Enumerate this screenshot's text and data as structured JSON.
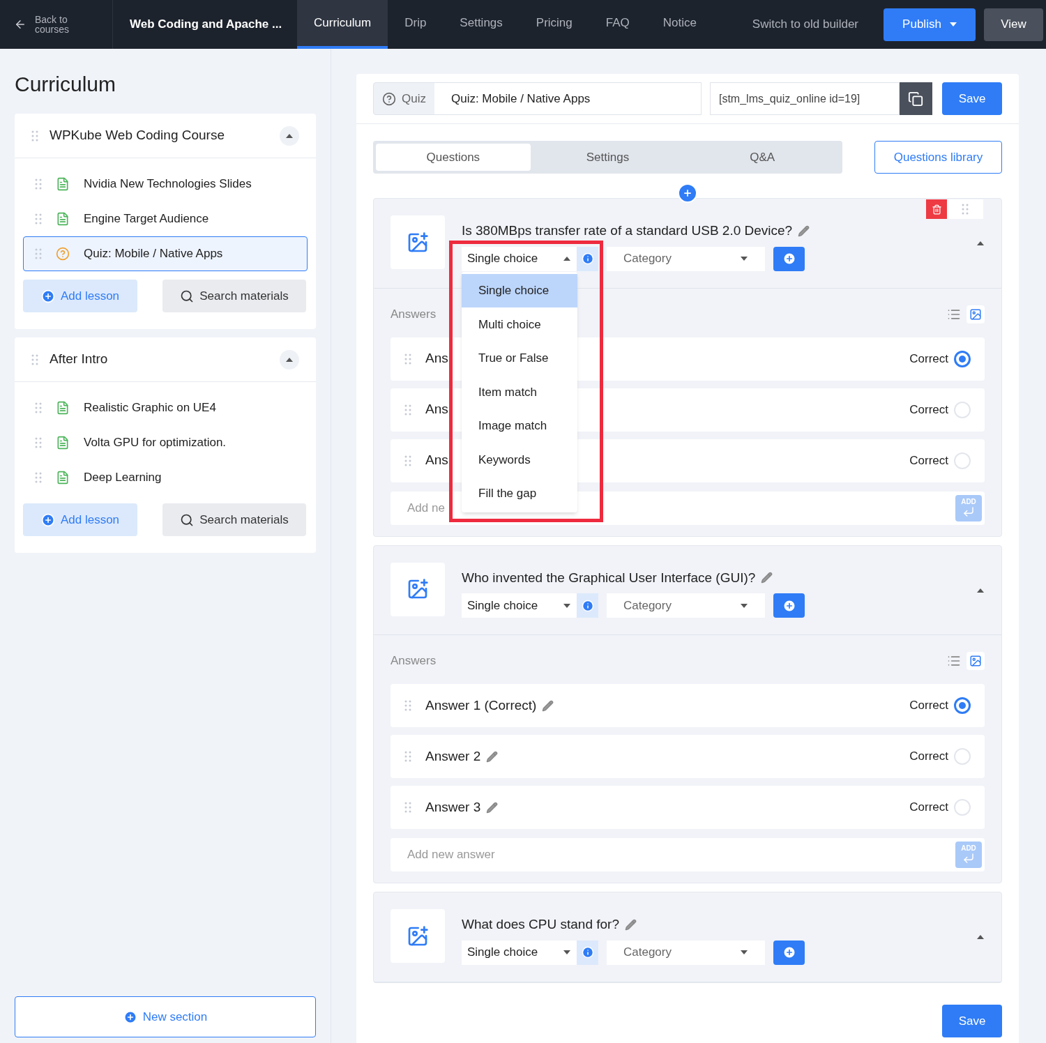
{
  "top_bar": {
    "back": "Back to courses",
    "course_title": "Web Coding and Apache ...",
    "tabs": [
      {
        "label": "Curriculum",
        "selected": true
      },
      {
        "label": "Drip",
        "selected": false
      },
      {
        "label": "Settings",
        "selected": false
      },
      {
        "label": "Pricing",
        "selected": false
      },
      {
        "label": "FAQ",
        "selected": false
      },
      {
        "label": "Notice",
        "selected": false
      }
    ],
    "switch_label": "Switch to old builder",
    "publish": "Publish",
    "view": "View"
  },
  "sidebar": {
    "title": "Curriculum",
    "sections": [
      {
        "title": "WPKube Web Coding Course",
        "expanded": true,
        "lessons": [
          {
            "title": "Nvidia New Technologies Slides",
            "kind": "text",
            "selected": false
          },
          {
            "title": "Engine Target Audience",
            "kind": "text",
            "selected": false
          },
          {
            "title": "Quiz: Mobile / Native Apps",
            "kind": "quiz",
            "selected": true
          }
        ],
        "add_lesson": "Add lesson",
        "search": "Search materials"
      },
      {
        "title": "After Intro",
        "expanded": true,
        "lessons": [
          {
            "title": "Realistic Graphic on UE4",
            "kind": "text",
            "selected": false
          },
          {
            "title": "Volta GPU for optimization.",
            "kind": "text",
            "selected": false
          },
          {
            "title": "Deep Learning",
            "kind": "text",
            "selected": false
          }
        ],
        "add_lesson": "Add lesson",
        "search": "Search materials"
      }
    ],
    "new_section": "New section"
  },
  "quiz": {
    "type_label": "Quiz",
    "title": "Quiz: Mobile / Native Apps",
    "shortcode": "[stm_lms_quiz_online id=19]",
    "save": "Save",
    "tabs": [
      {
        "label": "Questions",
        "selected": true
      },
      {
        "label": "Settings",
        "selected": false
      },
      {
        "label": "Q&A",
        "selected": false
      }
    ],
    "library": "Questions library",
    "questions": [
      {
        "title": "Is 380MBps transfer rate of a standard USB 2.0 Device?",
        "type": "Single choice",
        "category": "Category",
        "dropdown_open": true,
        "highlighted": true,
        "menu": [
          {
            "label": "Single choice",
            "selected": true
          },
          {
            "label": "Multi choice",
            "selected": false
          },
          {
            "label": "True or False",
            "selected": false
          },
          {
            "label": "Item match",
            "selected": false
          },
          {
            "label": "Image match",
            "selected": false
          },
          {
            "label": "Keywords",
            "selected": false
          },
          {
            "label": "Fill the gap",
            "selected": false
          }
        ],
        "answers_label": "Answers",
        "answers": [
          {
            "text": "Ans",
            "editable": false,
            "correct_label": "Correct",
            "correct": true
          },
          {
            "text": "Ans",
            "editable": false,
            "correct_label": "Correct",
            "correct": false
          },
          {
            "text": "Ans",
            "editable": false,
            "correct_label": "Correct",
            "correct": false
          }
        ],
        "add_placeholder": "Add ne",
        "add_label": "ADD"
      },
      {
        "title": "Who invented the Graphical User Interface (GUI)?",
        "type": "Single choice",
        "category": "Category",
        "dropdown_open": false,
        "highlighted": false,
        "answers_label": "Answers",
        "answers": [
          {
            "text": "Answer 1 (Correct)",
            "editable": true,
            "correct_label": "Correct",
            "correct": true
          },
          {
            "text": "Answer 2",
            "editable": true,
            "correct_label": "Correct",
            "correct": false
          },
          {
            "text": "Answer 3",
            "editable": true,
            "correct_label": "Correct",
            "correct": false
          }
        ],
        "add_placeholder": "Add new answer",
        "add_label": "ADD"
      },
      {
        "title": "What does CPU stand for?",
        "type": "Single choice",
        "category": "Category",
        "dropdown_open": false,
        "highlighted": false
      }
    ],
    "bottom_save": "Save"
  }
}
